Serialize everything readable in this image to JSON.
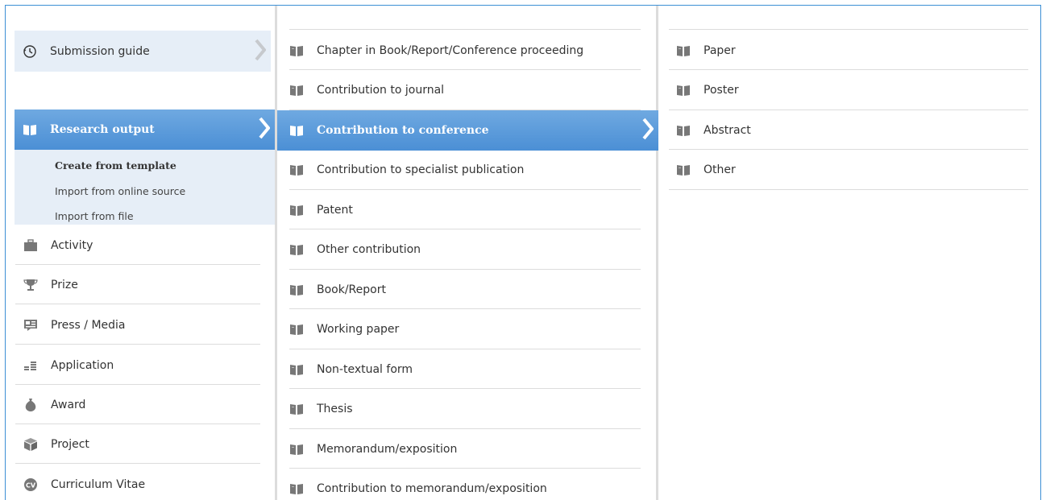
{
  "main_menu": {
    "submission_guide": "Submission guide",
    "research_output": "Research output",
    "sub_items": [
      "Create from template",
      "Import from online source",
      "Import from file"
    ],
    "items": [
      {
        "label": "Activity",
        "icon": "briefcase-icon"
      },
      {
        "label": "Prize",
        "icon": "trophy-icon"
      },
      {
        "label": "Press / Media",
        "icon": "newspaper-icon"
      },
      {
        "label": "Application",
        "icon": "coins-icon"
      },
      {
        "label": "Award",
        "icon": "money-bag-icon"
      },
      {
        "label": "Project",
        "icon": "cube-icon"
      },
      {
        "label": "Curriculum Vitae",
        "icon": "cv-icon"
      }
    ]
  },
  "output_types": {
    "items": [
      "Chapter in Book/Report/Conference proceeding",
      "Contribution to journal",
      "Contribution to conference",
      "Contribution to specialist publication",
      "Patent",
      "Other contribution",
      "Book/Report",
      "Working paper",
      "Non-textual form",
      "Thesis",
      "Memorandum/exposition",
      "Contribution to memorandum/exposition"
    ],
    "active_index": 2
  },
  "conference_types": {
    "items": [
      "Paper",
      "Poster",
      "Abstract",
      "Other"
    ]
  },
  "colors": {
    "accent": "#4b8fd5",
    "highlight_bg": "#e6eef7",
    "border": "#3c8fd4",
    "icon_gray": "#777777"
  }
}
